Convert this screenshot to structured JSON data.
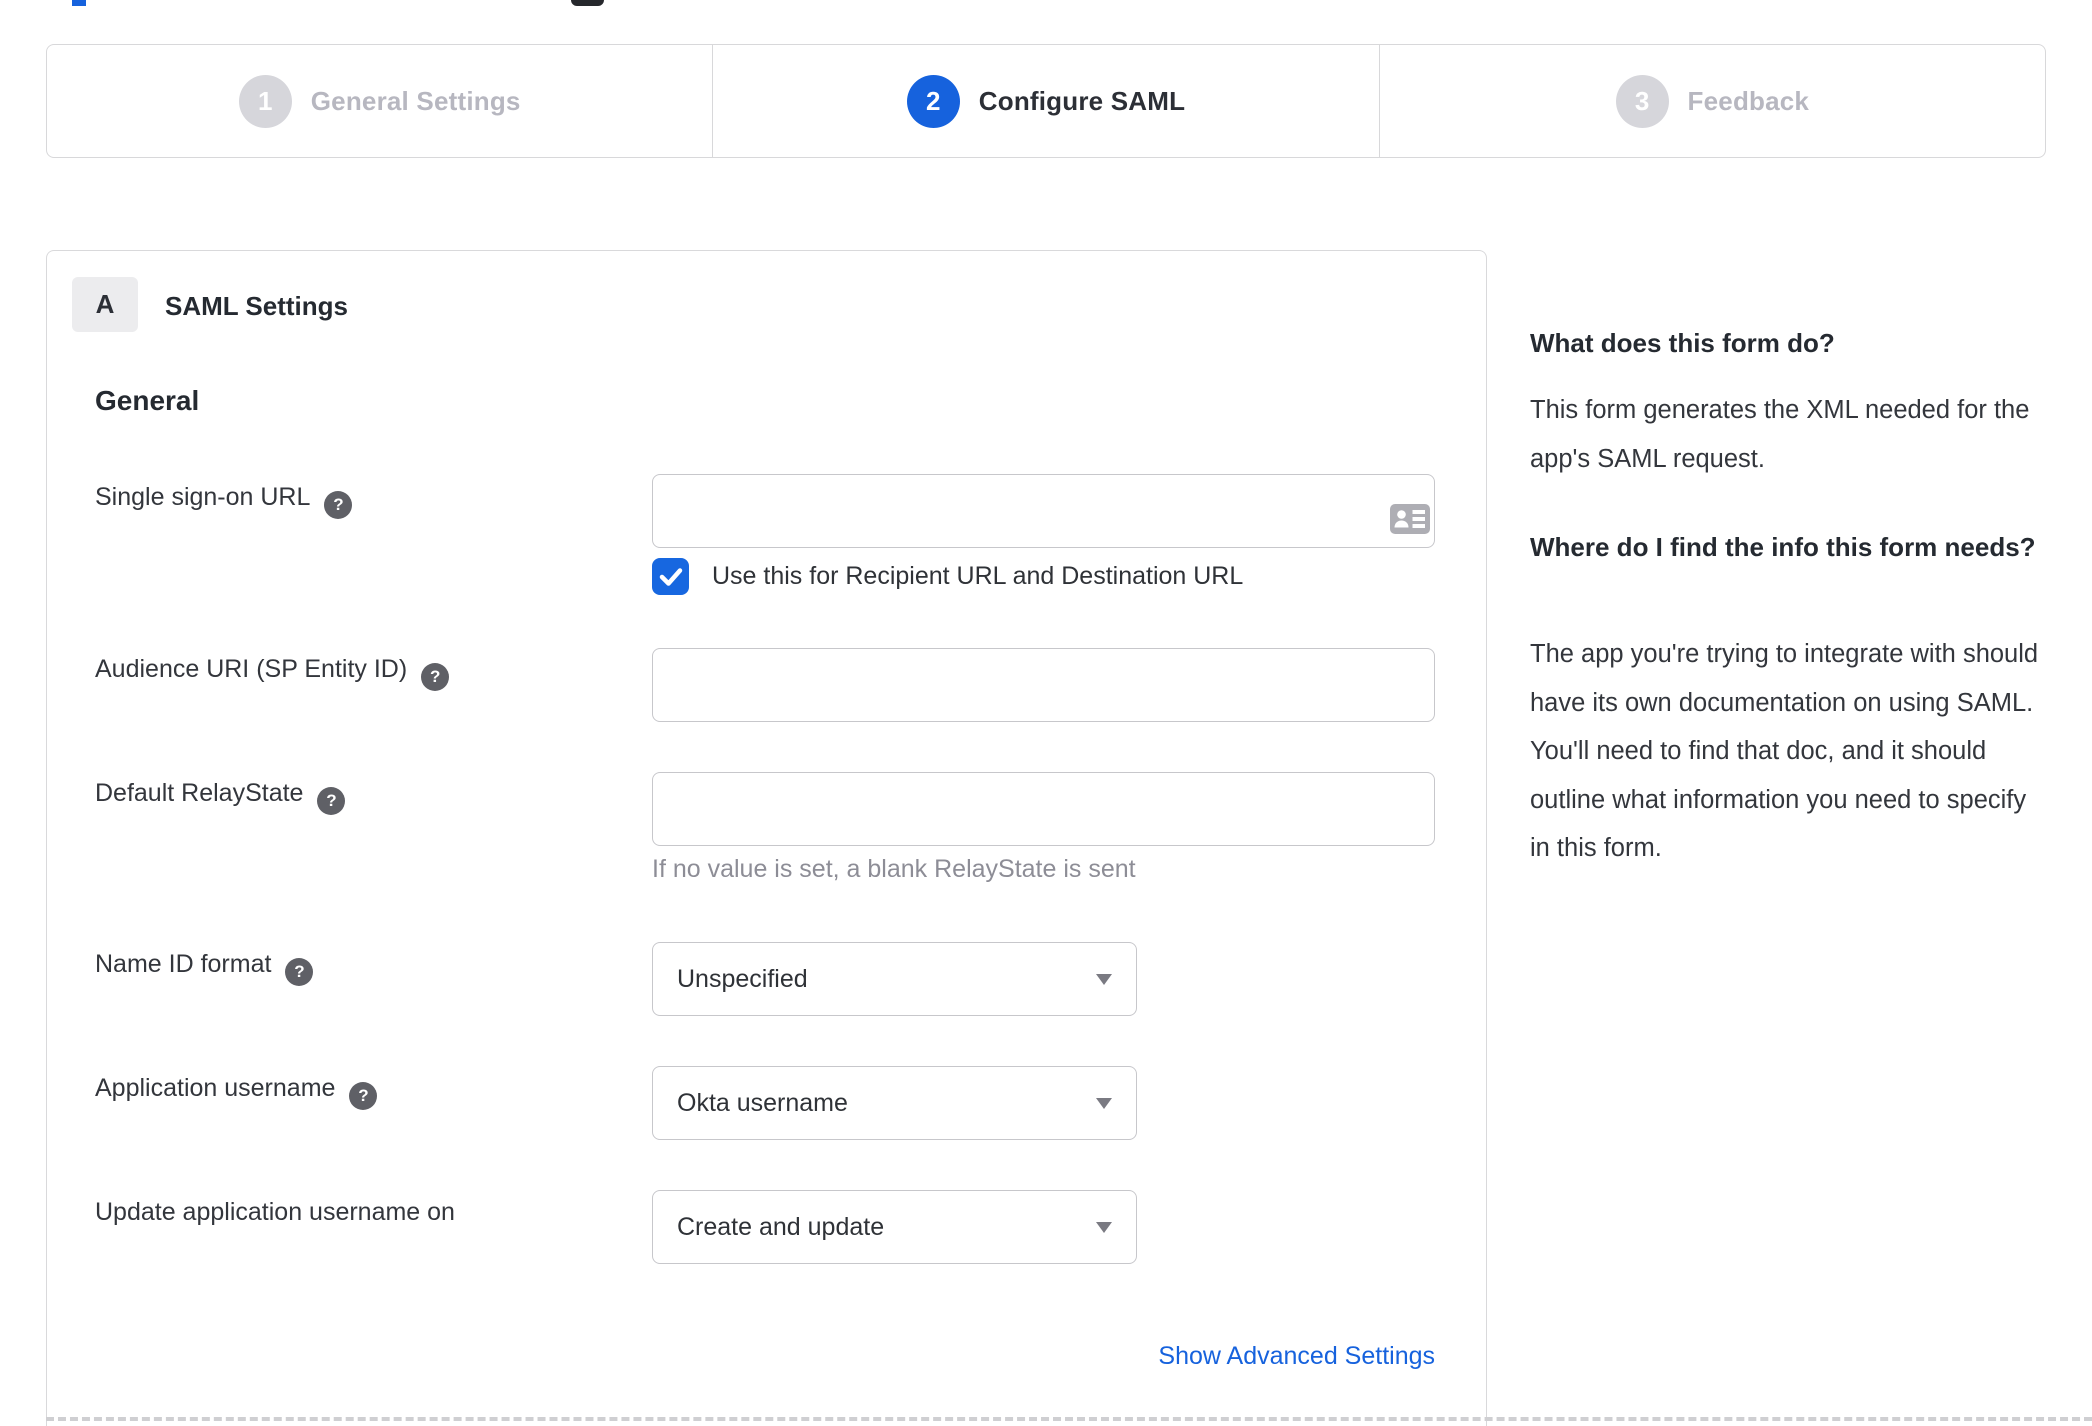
{
  "stepper": {
    "steps": [
      {
        "number": "1",
        "label": "General Settings",
        "state": "inactive"
      },
      {
        "number": "2",
        "label": "Configure SAML",
        "state": "active"
      },
      {
        "number": "3",
        "label": "Feedback",
        "state": "inactive"
      }
    ]
  },
  "icons": {
    "help_glyph": "?",
    "contact_card": "contact-card-icon"
  },
  "panel": {
    "section_badge": "A",
    "section_title": "SAML Settings",
    "group_title": "General",
    "fields": [
      {
        "label": "Single sign-on URL",
        "has_help": true,
        "type": "text",
        "value": "",
        "checkbox": {
          "checked": true,
          "label": "Use this for Recipient URL and Destination URL"
        }
      },
      {
        "label": "Audience URI (SP Entity ID)",
        "has_help": true,
        "type": "text",
        "value": ""
      },
      {
        "label": "Default RelayState",
        "has_help": true,
        "type": "text",
        "value": "",
        "hint": "If no value is set, a blank RelayState is sent"
      },
      {
        "label": "Name ID format",
        "has_help": true,
        "type": "select",
        "value": "Unspecified"
      },
      {
        "label": "Application username",
        "has_help": true,
        "type": "select",
        "value": "Okta username"
      },
      {
        "label": "Update application username on",
        "has_help": false,
        "type": "select",
        "value": "Create and update"
      }
    ],
    "advanced_link": "Show Advanced Settings"
  },
  "help_panel": {
    "sections": [
      {
        "heading": "What does this form do?",
        "body": "This form generates the XML needed for the app's SAML request."
      },
      {
        "heading": "Where do I find the info this form needs?",
        "body": "The app you're trying to integrate with should have its own documentation on using SAML. You'll need to find that doc, and it should outline what information you need to specify in this form."
      }
    ]
  },
  "colors": {
    "accent_blue": "#1662dd",
    "checkbox_blue": "#1767e0",
    "link_blue": "#1662dd",
    "inactive_circle": "#d6d6db",
    "inactive_label": "#b7b7c0",
    "panel_border": "#d9d9db",
    "hint_gray": "#8d8d96"
  }
}
